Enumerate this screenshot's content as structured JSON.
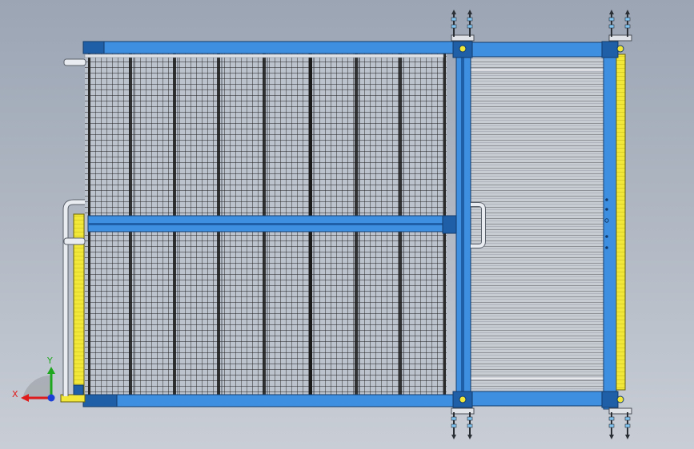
{
  "viewport": {
    "background_top": "#9ba5b4",
    "background_bottom": "#c9ced6"
  },
  "colors": {
    "frame_blue": "#3f8fe0",
    "frame_blue_dark": "#1f5fa8",
    "frame_edge": "#123b6b",
    "mesh_line": "#1a1a1a",
    "mesh_bg": "#bcc3cd",
    "yellow_rail": "#f2e83a",
    "rod_white": "#e9edf2",
    "axis_x": "#e01b1b",
    "axis_y": "#1fa81f",
    "axis_z": "#1c3fd6"
  },
  "triad": {
    "x_label": "X",
    "y_label": "Y",
    "icon": "coordinate-triad-icon"
  },
  "model": {
    "part": "fence-panel-assembly",
    "left_panel": "wire-mesh-panel",
    "right_panel": "slatted-gate-panel"
  }
}
